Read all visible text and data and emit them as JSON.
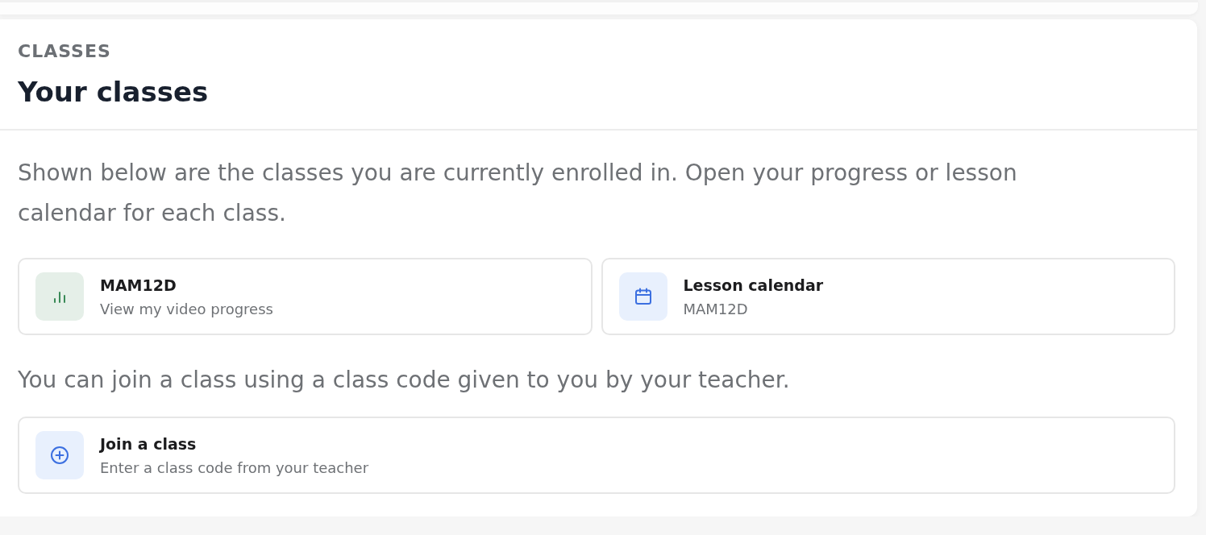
{
  "section": {
    "eyebrow": "CLASSES",
    "title": "Your classes"
  },
  "intro": "Shown below are the classes you are currently enrolled in. Open your progress or lesson calendar for each class.",
  "class_links": [
    {
      "kind": "progress",
      "title": "MAM12D",
      "subtitle": "View my video progress"
    },
    {
      "kind": "calendar",
      "title": "Lesson calendar",
      "subtitle": "MAM12D"
    }
  ],
  "join_intro": "You can join a class using a class code given to you by your teacher.",
  "join_link": {
    "kind": "join",
    "title": "Join a class",
    "subtitle": "Enter a class code from your teacher"
  }
}
